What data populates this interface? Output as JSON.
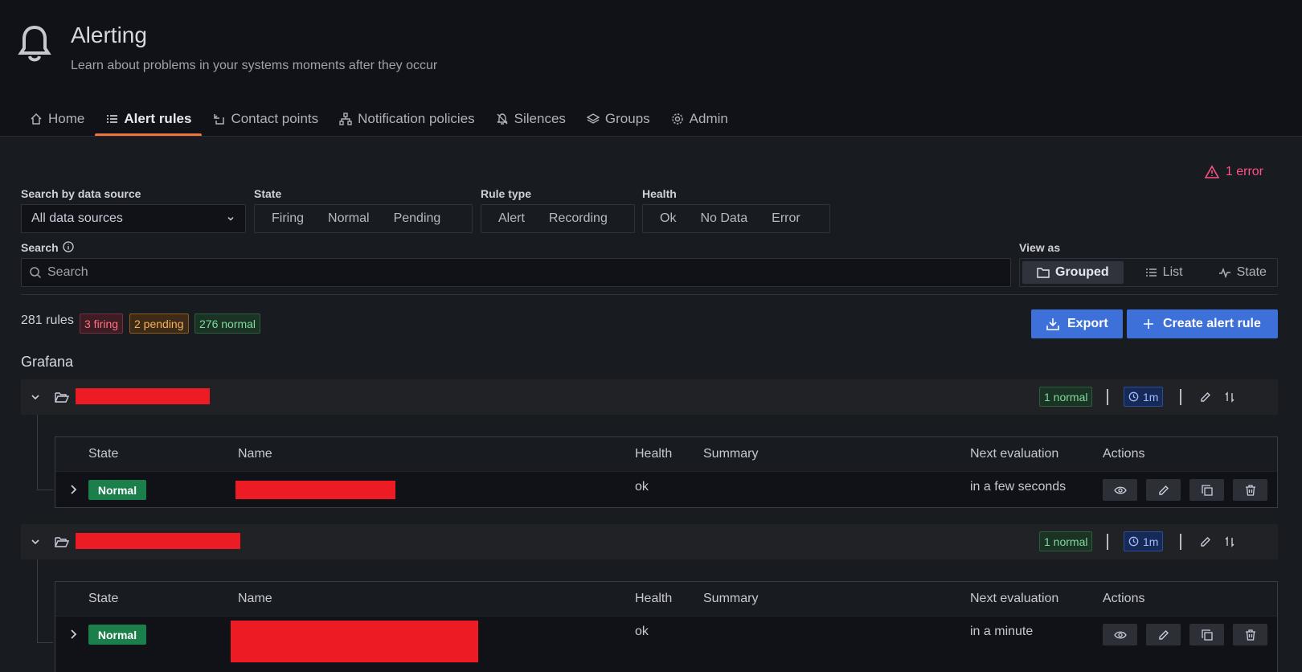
{
  "header": {
    "title": "Alerting",
    "subtitle": "Learn about problems in your systems moments after they occur",
    "tabs": [
      {
        "label": "Home"
      },
      {
        "label": "Alert rules"
      },
      {
        "label": "Contact points"
      },
      {
        "label": "Notification policies"
      },
      {
        "label": "Silences"
      },
      {
        "label": "Groups"
      },
      {
        "label": "Admin"
      }
    ]
  },
  "error_note": "1 error",
  "filters": {
    "datasource_label": "Search by data source",
    "datasource_value": "All data sources",
    "state_label": "State",
    "state_options": [
      "Firing",
      "Normal",
      "Pending"
    ],
    "ruletype_label": "Rule type",
    "ruletype_options": [
      "Alert",
      "Recording"
    ],
    "health_label": "Health",
    "health_options": [
      "Ok",
      "No Data",
      "Error"
    ],
    "search_label": "Search",
    "search_placeholder": "Search",
    "viewas_label": "View as",
    "viewas_options": [
      "Grouped",
      "List",
      "State"
    ]
  },
  "summary": {
    "count": "281 rules",
    "firing": "3 firing",
    "pending": "2 pending",
    "normal": "276 normal"
  },
  "actions": {
    "export": "Export",
    "create": "Create alert rule"
  },
  "source_title": "Grafana",
  "groups": [
    {
      "status": "1 normal",
      "interval": "1m",
      "columns": [
        "State",
        "Name",
        "Health",
        "Summary",
        "Next evaluation",
        "Actions"
      ],
      "row": {
        "state": "Normal",
        "health": "ok",
        "next": "in a few seconds"
      }
    },
    {
      "status": "1 normal",
      "interval": "1m",
      "columns": [
        "State",
        "Name",
        "Health",
        "Summary",
        "Next evaluation",
        "Actions"
      ],
      "row": {
        "state": "Normal",
        "health": "ok",
        "next": "in a minute"
      }
    }
  ]
}
